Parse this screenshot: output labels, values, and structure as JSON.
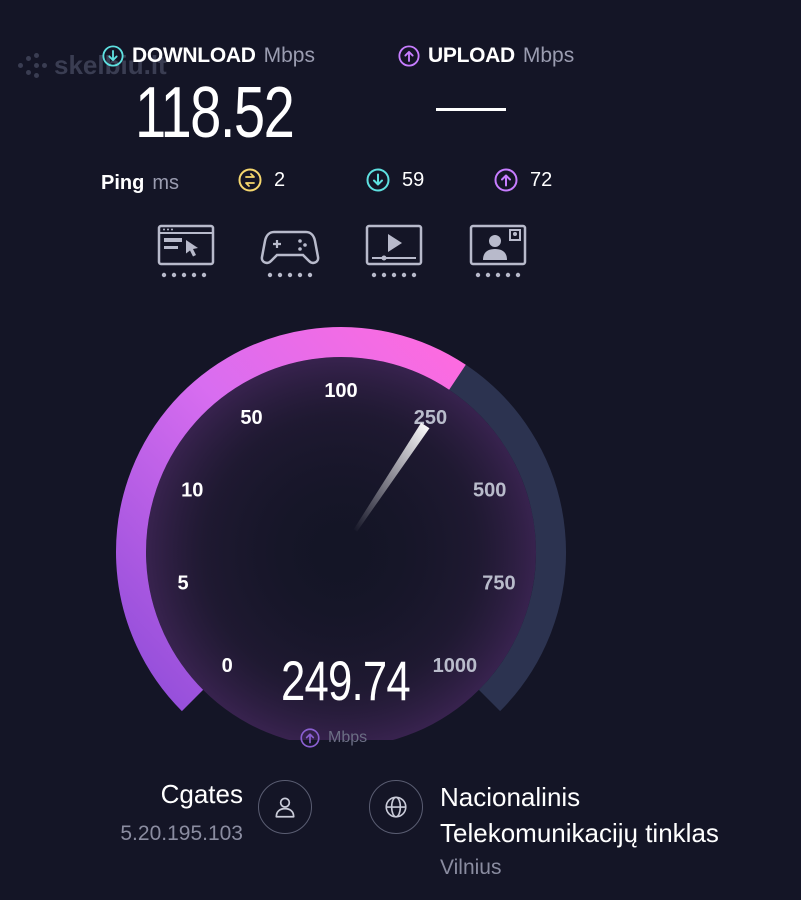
{
  "watermark": {
    "text": "skelbiu.lt"
  },
  "download": {
    "label": "DOWNLOAD",
    "unit": "Mbps",
    "value": "118.52",
    "icon": "download-arrow-icon",
    "color": "#5ee0e0"
  },
  "upload": {
    "label": "UPLOAD",
    "unit": "Mbps",
    "value": "",
    "icon": "upload-arrow-icon",
    "color": "#c77dff"
  },
  "ping": {
    "label": "Ping",
    "unit": "ms",
    "idle": {
      "value": "2",
      "icon": "ping-idle-icon",
      "color": "#f5d76e"
    },
    "download": {
      "value": "59",
      "icon": "download-latency-icon",
      "color": "#5ee0e0"
    },
    "upload": {
      "value": "72",
      "icon": "upload-latency-icon",
      "color": "#c77dff"
    }
  },
  "apps": [
    {
      "icon": "web-browsing-icon",
      "rating": 5
    },
    {
      "icon": "gaming-icon",
      "rating": 5
    },
    {
      "icon": "video-streaming-icon",
      "rating": 5
    },
    {
      "icon": "video-call-icon",
      "rating": 5
    }
  ],
  "gauge": {
    "ticks": [
      "0",
      "5",
      "10",
      "50",
      "100",
      "250",
      "500",
      "750",
      "1000"
    ],
    "current_value": 249.74,
    "current_label": "249.74",
    "unit": "Mbps",
    "unit_icon": "upload-arrow-icon",
    "arc_color_start": "#8e4cd8",
    "arc_color_end": "#ff6bdf",
    "track_color": "#2c3350"
  },
  "provider": {
    "name": "Cgates",
    "ip": "5.20.195.103",
    "icon": "user-icon"
  },
  "server": {
    "name": "Nacionalinis Telekomunikacijų tinklas",
    "location": "Vilnius",
    "icon": "globe-icon"
  }
}
